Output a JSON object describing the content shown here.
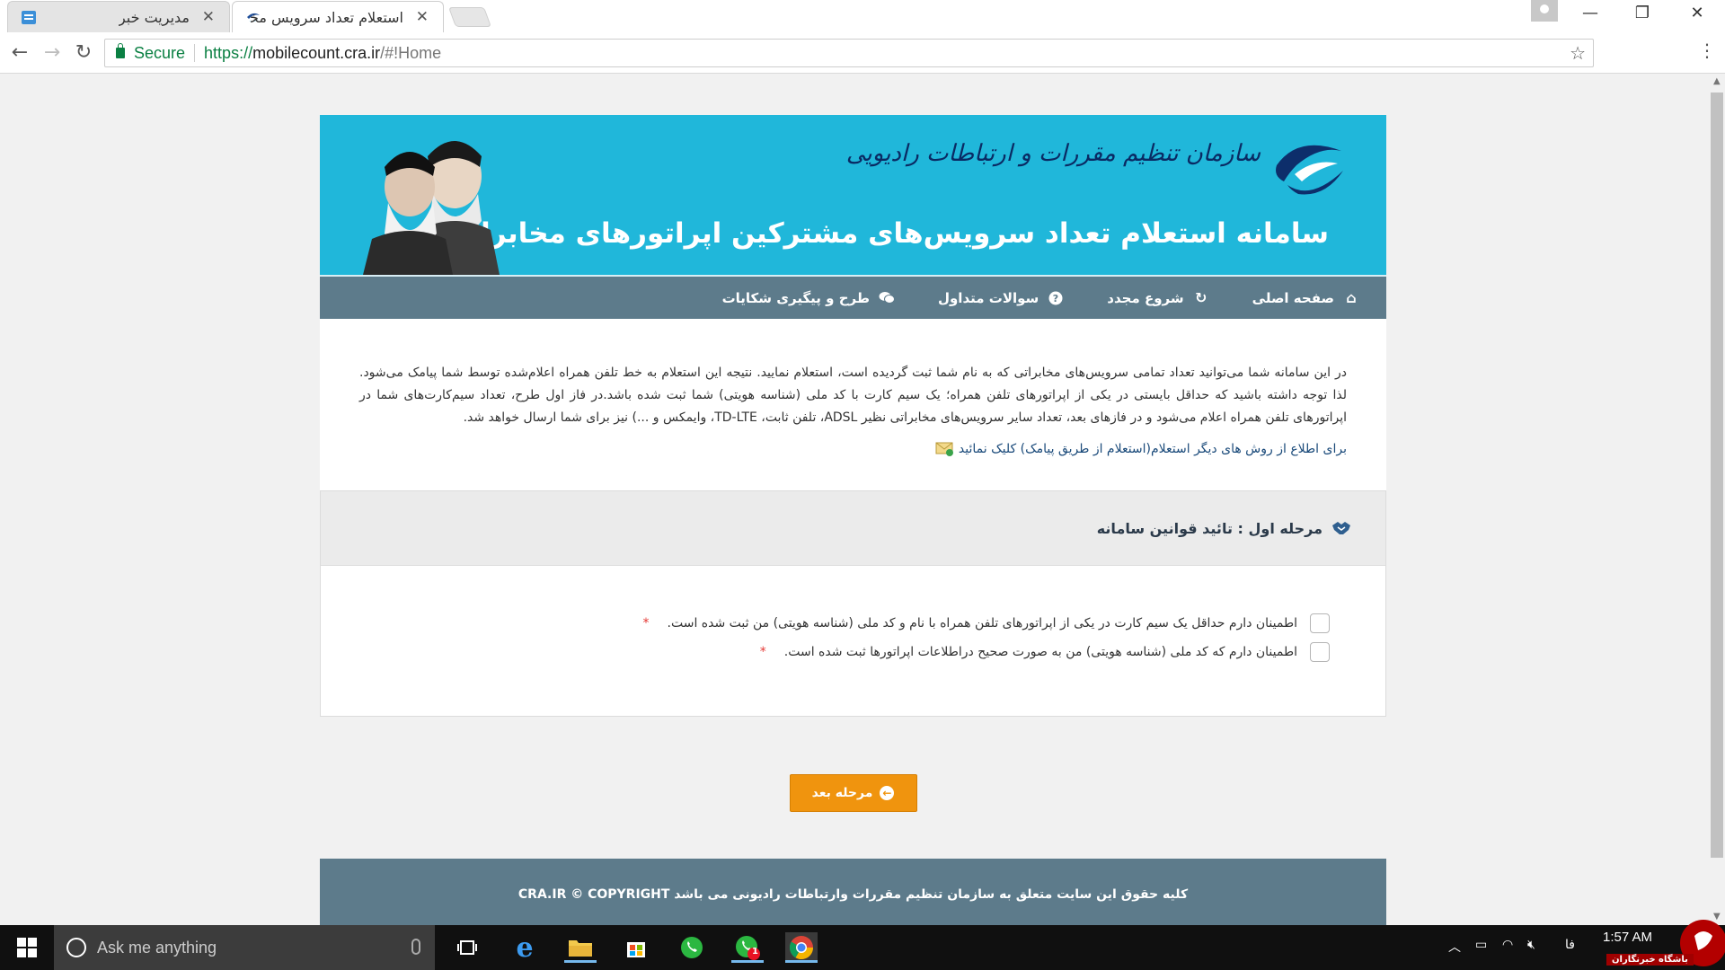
{
  "browser": {
    "tabs": [
      {
        "title": "مدیریت خبر",
        "active": false
      },
      {
        "title": "استعلام تعداد سرویس مخا",
        "active": true
      }
    ],
    "address": {
      "secure_label": "Secure",
      "url_scheme": "https://",
      "url_host": "mobilecount.cra.ir",
      "url_rest": "/#!Home"
    }
  },
  "header": {
    "org_name": "سازمان تنظیم مقررات و ارتباطات رادیویی",
    "system_title": "سامانه استعلام تعداد سرویس‌های مشترکین اپراتورهای مخابراتی",
    "background_color": "#20b7da"
  },
  "nav": {
    "items": [
      {
        "label": "صفحه اصلی",
        "icon": "home-icon"
      },
      {
        "label": "شروع مجدد",
        "icon": "refresh-icon"
      },
      {
        "label": "سوالات متداول",
        "icon": "question-circle-icon"
      },
      {
        "label": "طرح و پیگیری شکایات",
        "icon": "comments-icon"
      }
    ],
    "background_color": "#5d7b8b"
  },
  "intro": {
    "paragraph": "در این سامانه شما می‌توانید تعداد تمامی سرویس‌های مخابراتی که به نام شما ثبت گردیده است، استعلام نمایید. نتیجه این استعلام به خط تلفن همراه اعلام‌شده توسط شما پیامک می‌شود. لذا توجه داشته باشید که حداقل بایستی در یکی از اپراتورهای تلفن همراه؛ یک سیم کارت با کد ملی (شناسه هویتی) شما ثبت شده باشد.در فاز اول طرح، تعداد سیم‌کارت‌های شما در اپراتورهای تلفن همراه اعلام می‌شود و در فازهای بعد، تعداد سایر سرویس‌های مخابراتی نظیر ADSL، تلفن ثابت، TD-LTE، وایمکس و ...) نیز برای شما ارسال خواهد شد.",
    "sms_link": "برای اطلاع از روش های دیگر استعلام(استعلام از طریق پیامک) کلیک نمائید"
  },
  "step": {
    "title": "مرحله اول : تائید قوانین سامانه",
    "checks": [
      {
        "label": "اطمینان دارم حداقل یک سیم کارت در یکی از اپراتورهای تلفن همراه با نام و کد ملی (شناسه هویتی) من ثبت شده است.",
        "required_mark": "*"
      },
      {
        "label": "اطمینان دارم که کد ملی (شناسه هویتی) من به صورت صحیح دراطلاعات اپراتورها ثبت شده است.",
        "required_mark": "*"
      }
    ]
  },
  "next_button": {
    "label": "مرحله بعد",
    "color": "#f0940e"
  },
  "footer": {
    "text": "کلیه حقوق این سایت متعلق به سازمان تنظیم مقررات وارتباطات رادیونی می باشد CRA.IR © COPYRIGHT"
  },
  "taskbar": {
    "search_placeholder": "Ask me anything",
    "time": "1:57 AM",
    "lang": "فا",
    "whatsapp_badge": "1",
    "watermark": "باشگاه خبرنگاران"
  }
}
